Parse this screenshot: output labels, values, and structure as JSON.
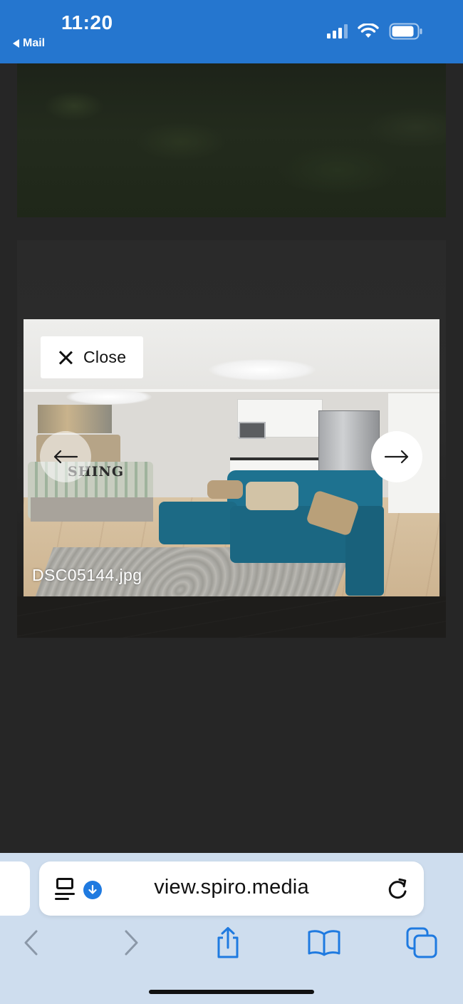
{
  "status_bar": {
    "time": "11:20",
    "back_app": "Mail",
    "icons": [
      "cellular-signal-icon",
      "wifi-icon",
      "battery-icon"
    ]
  },
  "lightbox": {
    "close_label": "Close",
    "filename": "DSC05144.jpg",
    "prev_icon": "arrow-left-icon",
    "next_icon": "arrow-right-icon",
    "bed_text": "SHING"
  },
  "safari": {
    "url": "view.spiro.media",
    "reader_icon": "page-menu-icon",
    "download_icon": "download-icon",
    "reload_icon": "reload-icon",
    "toolbar": [
      "back-icon",
      "forward-icon",
      "share-icon",
      "bookmarks-icon",
      "tabs-icon"
    ]
  },
  "colors": {
    "status_bar": "#2576cf",
    "page_background": "#262626",
    "safari_background": "#ceddee",
    "accent": "#1f7ae0",
    "sofa": "#1b6782"
  }
}
